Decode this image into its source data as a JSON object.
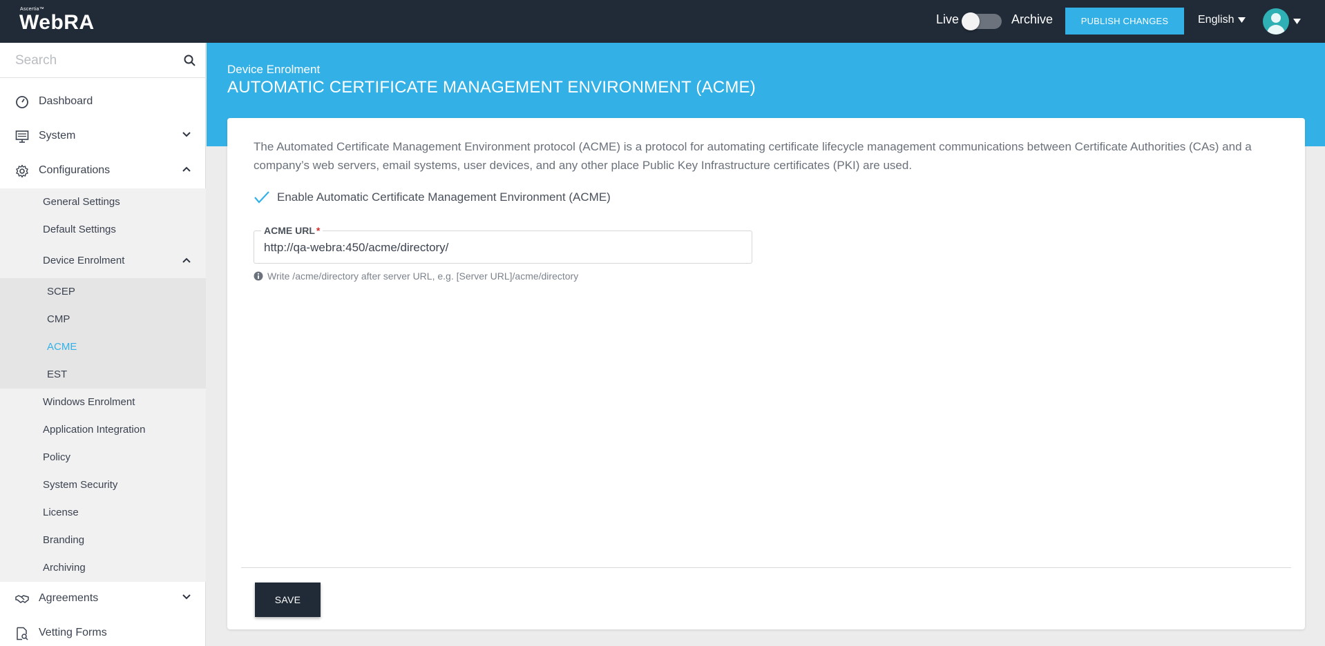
{
  "header": {
    "logo_small": "Ascertia™",
    "logo_text": "WebRA",
    "live_label": "Live",
    "archive_label": "Archive",
    "publish_label": "PUBLISH CHANGES",
    "language": "English"
  },
  "sidebar": {
    "search_placeholder": "Search",
    "dashboard": "Dashboard",
    "system": "System",
    "configurations": "Configurations",
    "config_items": {
      "general": "General Settings",
      "default": "Default Settings",
      "device_enrolment": "Device Enrolment",
      "scep": "SCEP",
      "cmp": "CMP",
      "acme": "ACME",
      "est": "EST",
      "windows": "Windows Enrolment",
      "app_integration": "Application Integration",
      "policy": "Policy",
      "system_security": "System Security",
      "license": "License",
      "branding": "Branding",
      "archiving": "Archiving"
    },
    "agreements": "Agreements",
    "vetting": "Vetting Forms"
  },
  "main": {
    "breadcrumb": "Device Enrolment",
    "title": "AUTOMATIC CERTIFICATE MANAGEMENT ENVIRONMENT (ACME)",
    "description": "The Automated Certificate Management Environment protocol (ACME) is a protocol for automating certificate lifecycle management communications between Certificate Authorities (CAs) and a company’s web servers, email systems, user devices, and any other place Public Key Infrastructure certificates (PKI) are used.",
    "enable_label": "Enable Automatic Certificate Management Environment (ACME)",
    "acme_url_label": "ACME URL",
    "acme_url_required": "*",
    "acme_url_value": "http://qa-webra:450/acme/directory/",
    "hint": "Write /acme/directory after server URL, e.g. [Server URL]/acme/directory",
    "save_label": "SAVE"
  },
  "colors": {
    "accent": "#33b1e6",
    "topbar": "#212b38"
  }
}
